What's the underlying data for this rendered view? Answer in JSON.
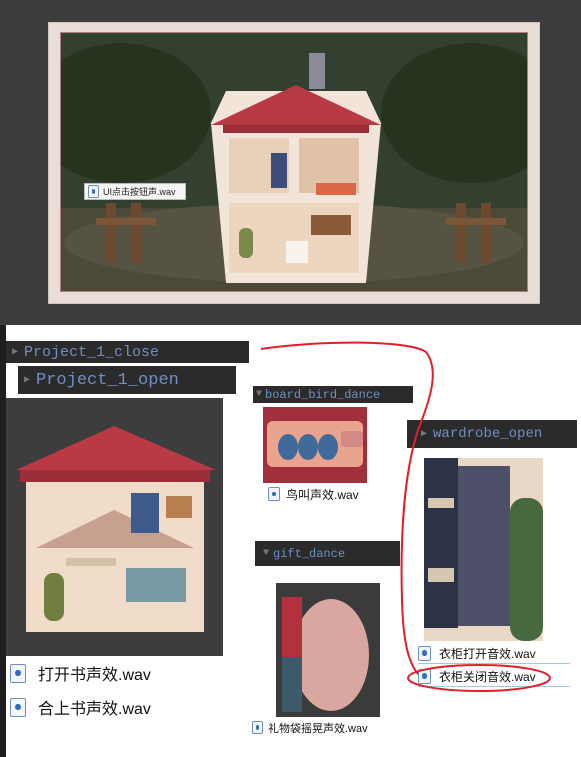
{
  "scene": {
    "label": "UI点击按钮声.wav"
  },
  "groups": [
    {
      "id": "project_close",
      "title": "Project_1_close"
    },
    {
      "id": "project_open",
      "title": "Project_1_open"
    },
    {
      "id": "board_bird",
      "title": "board_bird_dance"
    },
    {
      "id": "gift",
      "title": "gift_dance"
    },
    {
      "id": "wardrobe",
      "title": "wardrobe_open"
    }
  ],
  "files": {
    "book_open": "打开书声效.wav",
    "book_close": "合上书声效.wav",
    "bird": "鸟叫声效.wav",
    "gift_shake": "礼物袋摇晃声效.wav",
    "wardrobe_open": "衣柜打开音效.wav",
    "wardrobe_close": "衣柜关闭音效.wav"
  },
  "colors": {
    "annotation": "#e0202a",
    "header_text": "#6f8fc2",
    "header_bg": "#2b2b2b"
  }
}
